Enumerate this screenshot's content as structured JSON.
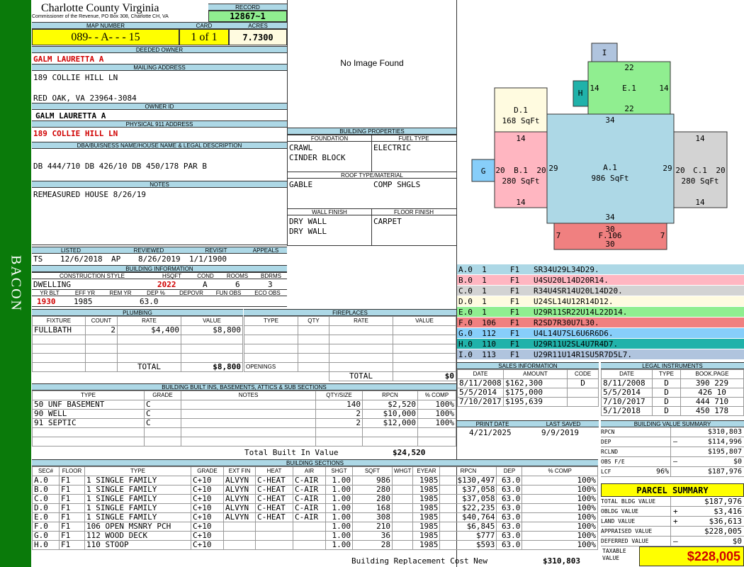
{
  "side_label": "BACON",
  "header": {
    "title": "Charlotte County Virginia",
    "subtitle": "Commissioner of the Revenue, PO Box 308, Charlotte CH, VA",
    "record_label": "RECORD",
    "record": "12867~1",
    "map_number_label": "MAP NUMBER",
    "map_number": "089- - A- - - 15",
    "card_label": "CARD",
    "card": "1 of 1",
    "acres_label": "ACRES",
    "acres": "7.7300"
  },
  "owner": {
    "deeded_owner_label": "DEEDED OWNER",
    "deeded_owner": "GALM LAURETTA A",
    "mailing_label": "MAILING ADDRESS",
    "mailing_line1": "189 COLLIE HILL LN",
    "mailing_line2": "RED OAK, VA 23964-3084",
    "owner_id_label": "OWNER ID",
    "owner_id": "GALM LAURETTA A",
    "physical_label": "PHYSICAL 911 ADDRESS",
    "physical": "189 COLLIE HILL LN",
    "legal_label": "DBA/BUISNESS NAME/HOUSE NAME & LEGAL DESCRIPTION",
    "legal": "DB 444/710 DB 426/10 DB 450/178 PAR B",
    "notes_label": "NOTES",
    "notes": "REMEASURED HOUSE 8/26/19"
  },
  "image_placeholder": "No Image Found",
  "building_properties": {
    "title": "BUILDING PROPERTIES",
    "foundation_label": "FOUNDATION",
    "foundation1": "CRAWL",
    "foundation2": "CINDER BLOCK",
    "fuel_label": "FUEL TYPE",
    "fuel": "ELECTRIC",
    "roof_label": "ROOF TYPE/MATERIAL",
    "roof_type": "GABLE",
    "roof_material": "COMP SHGLS",
    "wall_label": "WALL FINISH",
    "wall1": "DRY WALL",
    "wall2": "DRY WALL",
    "floor_label": "FLOOR FINISH",
    "floor": "CARPET"
  },
  "dates": {
    "listed_label": "LISTED",
    "reviewed_label": "REVIEWED",
    "revisit_label": "REVISIT",
    "appeals_label": "APPEALS",
    "listed_by": "TS",
    "listed": "12/6/2018",
    "reviewed_by": "AP",
    "reviewed": "8/26/2019",
    "revisit": "1/1/1900"
  },
  "building_info": {
    "title": "BUILDING INFORMATION",
    "style_label": "CONSTRUCTION STYLE",
    "hsqft_label": "HSQFT",
    "cond_label": "COND",
    "rooms_label": "ROOMS",
    "bdrms_label": "BDRMS",
    "style": "DWELLING",
    "hsqft": "2022",
    "cond": "A",
    "rooms": "6",
    "bdrms": "3",
    "yrblt_label": "YR BLT",
    "effyr_label": "EFF YR",
    "remyr_label": "REM YR",
    "dep_label": "DEP %",
    "depovr_label": "DEPOVR",
    "funobs_label": "FUN OBS",
    "ecoobs_label": "ECO OBS",
    "yrblt": "1930",
    "effyr": "1985",
    "dep": "63.0"
  },
  "plumbing": {
    "title": "PLUMBING",
    "headers": [
      "FIXTURE",
      "COUNT",
      "RATE",
      "VALUE"
    ],
    "rows": [
      [
        "FULLBATH",
        "2",
        "$4,400",
        "$8,800"
      ]
    ],
    "total_label": "TOTAL",
    "total": "$8,800"
  },
  "fireplaces": {
    "title": "FIREPLACES",
    "headers": [
      "TYPE",
      "QTY",
      "RATE",
      "VALUE"
    ],
    "openings_label": "OPENINGS",
    "total_label": "TOTAL",
    "total": "$0"
  },
  "builtins": {
    "title": "BUILDING BUILT INS, BASEMENTS, ATTICS & SUB SECTIONS",
    "headers": [
      "TYPE",
      "GRADE",
      "NOTES",
      "QTY/SIZE",
      "RPCN",
      "% COMP"
    ],
    "rows": [
      [
        "50 UNF BASEMENT",
        "C",
        "",
        "140",
        "$2,520",
        "100%"
      ],
      [
        "90 WELL",
        "C",
        "",
        "2",
        "$10,000",
        "100%"
      ],
      [
        "91 SEPTIC",
        "C",
        "",
        "2",
        "$12,000",
        "100%"
      ]
    ],
    "total_label": "Total Built In Value",
    "total": "$24,520"
  },
  "sections": {
    "title": "BUILDING SECTIONS",
    "headers": [
      "SEC#",
      "FLOOR",
      "TYPE",
      "GRADE",
      "EXT FIN",
      "HEAT",
      "AIR",
      "SHGT",
      "SQFT",
      "WHGT",
      "EYEAR",
      "RPCN",
      "DEP",
      "% COMP"
    ],
    "rows": [
      [
        "A.0",
        "F1",
        "1 SINGLE FAMILY",
        "C+10",
        "ALVYN",
        "C-HEAT",
        "C-AIR",
        "1.00",
        "986",
        "",
        "1985",
        "$130,497",
        "63.0",
        "100%"
      ],
      [
        "B.0",
        "F1",
        "1 SINGLE FAMILY",
        "C+10",
        "ALVYN",
        "C-HEAT",
        "C-AIR",
        "1.00",
        "280",
        "",
        "1985",
        "$37,058",
        "63.0",
        "100%"
      ],
      [
        "C.0",
        "F1",
        "1 SINGLE FAMILY",
        "C+10",
        "ALVYN",
        "C-HEAT",
        "C-AIR",
        "1.00",
        "280",
        "",
        "1985",
        "$37,058",
        "63.0",
        "100%"
      ],
      [
        "D.0",
        "F1",
        "1 SINGLE FAMILY",
        "C+10",
        "ALVYN",
        "C-HEAT",
        "C-AIR",
        "1.00",
        "168",
        "",
        "1985",
        "$22,235",
        "63.0",
        "100%"
      ],
      [
        "E.0",
        "F1",
        "1 SINGLE FAMILY",
        "C+10",
        "ALVYN",
        "C-HEAT",
        "C-AIR",
        "1.00",
        "308",
        "",
        "1985",
        "$40,764",
        "63.0",
        "100%"
      ],
      [
        "F.0",
        "F1",
        "106 OPEN MSNRY PCH",
        "C+10",
        "",
        "",
        "",
        "1.00",
        "210",
        "",
        "1985",
        "$6,845",
        "63.0",
        "100%"
      ],
      [
        "G.0",
        "F1",
        "112 WOOD DECK",
        "C+10",
        "",
        "",
        "",
        "1.00",
        "36",
        "",
        "1985",
        "$777",
        "63.0",
        "100%"
      ],
      [
        "H.0",
        "F1",
        "110 STOOP",
        "C+10",
        "",
        "",
        "",
        "1.00",
        "28",
        "",
        "1985",
        "$593",
        "63.0",
        "100%"
      ]
    ],
    "total_label": "Building Replacement Cost New",
    "total": "$310,803"
  },
  "sketch": {
    "A": {
      "name": "A.1",
      "area": "986 SqFt",
      "top": "34",
      "bottom": "34",
      "left": "29",
      "right": "29"
    },
    "B": {
      "name": "B.1",
      "area": "280 SqFt",
      "top": "14",
      "bottom": "14",
      "left": "20",
      "right": "20"
    },
    "C": {
      "name": "C.1",
      "area": "280 SqFt",
      "top": "14",
      "bottom": "14",
      "left": "20",
      "right": "20"
    },
    "D": {
      "name": "D.1",
      "area": "168 SqFt"
    },
    "E": {
      "name": "E.1",
      "top": "22",
      "bottom": "22",
      "left": "14",
      "right": "14"
    },
    "F": {
      "name": "F.106",
      "top": "30",
      "bottom": "30",
      "left": "7",
      "right": "7"
    },
    "G": {
      "name": "G"
    },
    "H": {
      "name": "H"
    },
    "I": {
      "name": "I"
    }
  },
  "sketch_legend": [
    {
      "text": "A.0  1     F1   SR34U29L34D29.",
      "color": "#add8e6"
    },
    {
      "text": "B.0  1     F1   U4SU20L14D20R14.",
      "color": "#ffb6c1"
    },
    {
      "text": "C.0  1     F1   R34U4SR14U20L14D20.",
      "color": "#d3d3d3"
    },
    {
      "text": "D.0  1     F1   U24SL14U12R14D12.",
      "color": "#fffbe0"
    },
    {
      "text": "E.0  1     F1   U29R11SR22U14L22D14.",
      "color": "#90ee90"
    },
    {
      "text": "F.0  106   F1   R2SD7R30U7L30.",
      "color": "#f08080"
    },
    {
      "text": "G.0  112   F1   U4L14U7SL6U6R6D6.",
      "color": "#87cefa"
    },
    {
      "text": "H.0  110   F1   U29R11U2SL4U7R4D7.",
      "color": "#20b2aa"
    },
    {
      "text": "I.0  113   F1   U29R11U14R1SU5R7D5L7.",
      "color": "#b0c4de"
    }
  ],
  "sales": {
    "title": "SALES INFORMATION",
    "headers": [
      "DATE",
      "AMOUNT",
      "CODE"
    ],
    "rows": [
      [
        "8/11/2008",
        "$162,300",
        "D"
      ],
      [
        "5/5/2014",
        "$175,000",
        ""
      ],
      [
        "7/10/2017",
        "$195,639",
        ""
      ]
    ]
  },
  "legal_instruments": {
    "title": "LEGAL INSTRUMENTS",
    "headers": [
      "DATE",
      "TYPE",
      "BOOK.PAGE"
    ],
    "rows": [
      [
        "8/11/2008",
        "D",
        "390 229"
      ],
      [
        "5/5/2014",
        "D",
        "426 10"
      ],
      [
        "7/10/2017",
        "D",
        "444 710"
      ],
      [
        "5/1/2018",
        "D",
        "450 178"
      ]
    ]
  },
  "print_info": {
    "print_label": "PRINT DATE",
    "print_date": "4/21/2025",
    "saved_label": "LAST SAVED",
    "saved_date": "9/9/2019"
  },
  "value_summary": {
    "title": "BUILDING VALUE SUMMARY",
    "rows": [
      {
        "label": "RPCN",
        "sign": "",
        "value": "$310,803"
      },
      {
        "label": "DEP",
        "sign": "–",
        "value": "$114,996"
      },
      {
        "label": "RCLND",
        "sign": "",
        "value": "$195,807"
      },
      {
        "label": "OBS F/E",
        "sign": "–",
        "value": "$0"
      },
      {
        "label": "LCF",
        "pct": "96%",
        "sign": "",
        "value": "$187,976"
      }
    ]
  },
  "parcel_summary": {
    "title": "PARCEL SUMMARY",
    "rows": [
      {
        "label": "TOTAL BLDG VALUE",
        "sign": "",
        "value": "$187,976"
      },
      {
        "label": "OBLDG VALUE",
        "sign": "+",
        "value": "$3,416"
      },
      {
        "label": "LAND VALUE",
        "sign": "+",
        "value": "$36,613"
      },
      {
        "label": "APPRAISED VALUE",
        "sign": "",
        "value": "$228,005"
      },
      {
        "label": "DEFERRED VALUE",
        "sign": "–",
        "value": "$0"
      }
    ],
    "taxable_label": "TAXABLE VALUE",
    "taxable": "$228,005"
  }
}
